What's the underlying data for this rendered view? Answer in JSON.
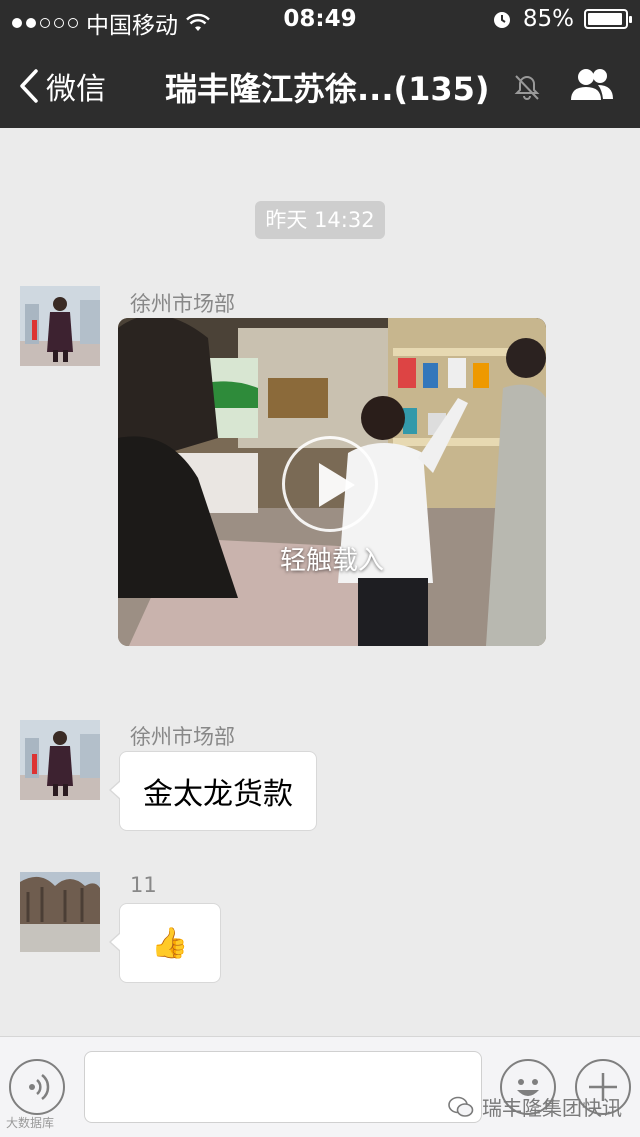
{
  "status_bar": {
    "carrier": "中国移动",
    "time": "08:49",
    "battery": "85%",
    "signal_filled": 2,
    "signal_total": 5
  },
  "nav": {
    "back_label": "微信",
    "title": "瑞丰隆江苏徐...(135)"
  },
  "chat": {
    "timestamp": "昨天 14:32",
    "messages": [
      {
        "sender": "徐州市场部",
        "video_caption": "轻触载入"
      },
      {
        "sender": "徐州市场部",
        "text": "金太龙货款"
      },
      {
        "sender": "11",
        "emoji": "👍"
      }
    ]
  },
  "watermark": {
    "text": "瑞丰隆集团快讯",
    "left_text": "大数据库"
  },
  "icons": [
    "back-chevron-icon",
    "mute-bell-icon",
    "members-icon",
    "play-icon",
    "voice-icon",
    "emoji-icon",
    "plus-icon",
    "wechat-icon",
    "wifi-icon",
    "alarm-icon",
    "battery-icon"
  ]
}
